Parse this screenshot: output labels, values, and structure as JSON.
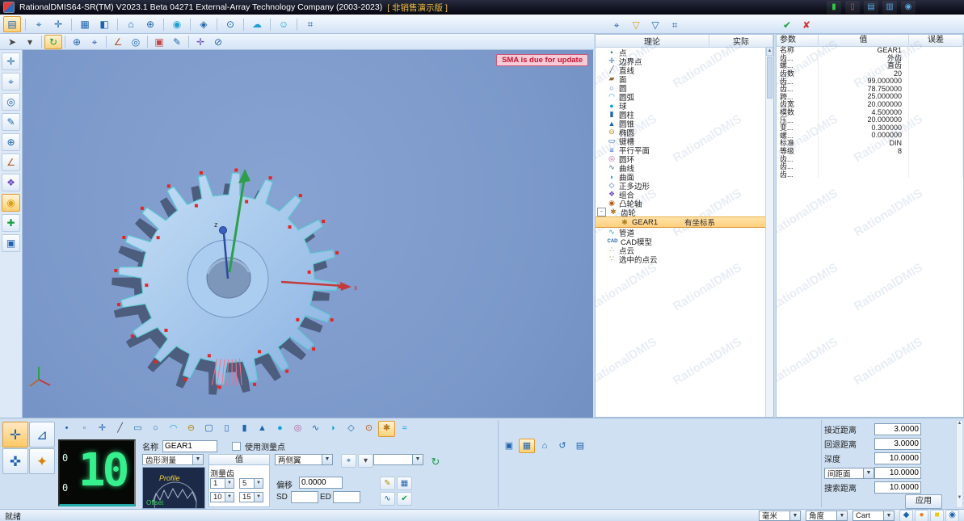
{
  "window": {
    "title": "RationalDMIS64-SR(TM) V2023.1 Beta 04271   External-Array Technology Company (2003-2023)",
    "edition": "[ 非销售演示版 ]"
  },
  "watermark": "RationalDMIS",
  "colors": {
    "selection": "#ffd27f",
    "lcd_green": "#35f08c",
    "viewport": "#7f9ccd",
    "accent_blue": "#1f63b0"
  },
  "viewport": {
    "notice": "SMA is due for update",
    "axis_z": "z",
    "axis_x": "x"
  },
  "gear": {
    "teeth": 20
  },
  "titlebar_icons": [
    {
      "name": "online-status",
      "glyph": "▮",
      "color": "#2ecc40"
    },
    {
      "name": "machine-offline",
      "glyph": "▯",
      "color": "#e74c3c"
    },
    {
      "name": "display-1",
      "glyph": "▤",
      "color": "#5aa9e6"
    },
    {
      "name": "display-2",
      "glyph": "▥",
      "color": "#5aa9e6"
    },
    {
      "name": "help",
      "glyph": "◉",
      "color": "#5aa9e6"
    }
  ],
  "toolbars": {
    "ribbon": [
      {
        "name": "file-tab",
        "glyph": "▤",
        "color": "#1f63b0",
        "active": true
      },
      {
        "sep": true
      },
      {
        "name": "probe-tab",
        "glyph": "⌖",
        "color": "#1f63b0"
      },
      {
        "name": "coordinate-tab",
        "glyph": "✛",
        "color": "#1f63b0"
      },
      {
        "sep": true
      },
      {
        "name": "table-tab",
        "glyph": "▦",
        "color": "#1f63b0"
      },
      {
        "name": "view-tab",
        "glyph": "◧",
        "color": "#1f63b0"
      },
      {
        "sep": true
      },
      {
        "name": "monitor-tab",
        "glyph": "⌂",
        "color": "#1f63b0"
      },
      {
        "name": "measure-tab",
        "glyph": "⊕",
        "color": "#1f63b0"
      },
      {
        "sep": true
      },
      {
        "name": "droplet-tab",
        "glyph": "◉",
        "color": "#18a0d8"
      },
      {
        "sep": true
      },
      {
        "name": "tolerance-tab",
        "glyph": "◈",
        "color": "#1f63b0"
      },
      {
        "sep": true
      },
      {
        "name": "gauge-tab",
        "glyph": "⊙",
        "color": "#1f63b0"
      },
      {
        "sep": true
      },
      {
        "name": "cloud-tab",
        "glyph": "☁",
        "color": "#18a0d8"
      },
      {
        "sep": true
      },
      {
        "name": "report-tab",
        "glyph": "☺",
        "color": "#18a0d8"
      },
      {
        "sep": true
      },
      {
        "name": "screen-tab",
        "glyph": "⌗",
        "color": "#1f63b0"
      }
    ],
    "quick": [
      {
        "name": "select-arrow",
        "glyph": "➤",
        "color": "#444"
      },
      {
        "name": "select-dropdown",
        "glyph": "▾",
        "color": "#444"
      },
      {
        "sep": true
      },
      {
        "name": "refresh-view",
        "glyph": "↻",
        "color": "#189e3f",
        "active": true
      },
      {
        "sep": true
      },
      {
        "name": "zoom",
        "glyph": "⊕",
        "color": "#1f63b0"
      },
      {
        "name": "locate",
        "glyph": "⌖",
        "color": "#1f63b0"
      },
      {
        "sep": true
      },
      {
        "name": "angle-tool",
        "glyph": "∠",
        "color": "#b05a1e"
      },
      {
        "name": "view-eye",
        "glyph": "◎",
        "color": "#1f63b0"
      },
      {
        "sep": true
      },
      {
        "name": "paint-surface",
        "glyph": "▣",
        "color": "#c04848"
      },
      {
        "name": "edit-tool",
        "glyph": "✎",
        "color": "#1f63b0"
      },
      {
        "sep": true
      },
      {
        "name": "probe-tool",
        "glyph": "✛",
        "color": "#6a48c0"
      },
      {
        "name": "clip-tool",
        "glyph": "⊘",
        "color": "#1f63b0"
      }
    ],
    "tree_toolbar": [
      {
        "name": "probe-display",
        "glyph": "⌖",
        "color": "#1f63b0"
      },
      {
        "name": "filter-coordinate",
        "glyph": "▽",
        "color": "#d8a018"
      },
      {
        "name": "filter-feature",
        "glyph": "▽",
        "color": "#1f63b0"
      },
      {
        "name": "report-display",
        "glyph": "⌗",
        "color": "#1f63b0"
      }
    ],
    "param_toolbar": [
      {
        "name": "confirm",
        "glyph": "✔",
        "color": "#189e3f"
      },
      {
        "name": "cancel",
        "glyph": "✘",
        "color": "#d03030"
      }
    ],
    "left_strip": [
      {
        "name": "coordinate-tool",
        "glyph": "✛",
        "color": "#1f63b0"
      },
      {
        "name": "probe-point",
        "glyph": "⌖",
        "color": "#1f63b0"
      },
      {
        "name": "view-rotate",
        "glyph": "◎",
        "color": "#1f63b0"
      },
      {
        "name": "annotate",
        "glyph": "✎",
        "color": "#1f63b0"
      },
      {
        "name": "zoom-fit",
        "glyph": "⊕",
        "color": "#1f63b0"
      },
      {
        "name": "angle-measure",
        "glyph": "∠",
        "color": "#b05a1e"
      },
      {
        "name": "combine-feature",
        "glyph": "❖",
        "color": "#6a48c0"
      },
      {
        "name": "gear-measure",
        "glyph": "◉",
        "color": "#d8a018",
        "active": true
      },
      {
        "name": "add-feature",
        "glyph": "✚",
        "color": "#189e3f"
      },
      {
        "name": "scene-settings",
        "glyph": "▣",
        "color": "#1f63b0"
      }
    ],
    "shapes": [
      {
        "name": "feature-point",
        "glyph": "•",
        "color": "#1f63b0"
      },
      {
        "name": "feature-auto-point",
        "glyph": "◦",
        "color": "#1f63b0"
      },
      {
        "name": "feature-edge-point",
        "glyph": "✛",
        "color": "#1f63b0"
      },
      {
        "name": "feature-line",
        "glyph": "╱",
        "color": "#445"
      },
      {
        "name": "feature-plane",
        "glyph": "▭",
        "color": "#1f63b0"
      },
      {
        "name": "feature-circle",
        "glyph": "○",
        "color": "#1f63b0"
      },
      {
        "name": "feature-arc",
        "glyph": "◠",
        "color": "#18a0d8"
      },
      {
        "name": "feature-ellipse",
        "glyph": "⊖",
        "color": "#b8860b"
      },
      {
        "name": "feature-slot",
        "glyph": "▢",
        "color": "#1f63b0"
      },
      {
        "name": "feature-rectangle",
        "glyph": "▯",
        "color": "#1f63b0"
      },
      {
        "name": "feature-cylinder",
        "glyph": "▮",
        "color": "#1f63b0"
      },
      {
        "name": "feature-cone",
        "glyph": "▲",
        "color": "#1f63b0"
      },
      {
        "name": "feature-sphere",
        "glyph": "●",
        "color": "#18a0d8"
      },
      {
        "name": "feature-torus",
        "glyph": "◎",
        "color": "#b05a9e"
      },
      {
        "name": "feature-curve",
        "glyph": "∿",
        "color": "#1f63b0"
      },
      {
        "name": "feature-surface",
        "glyph": "◗",
        "color": "#18a0d8"
      },
      {
        "name": "feature-polygon",
        "glyph": "◇",
        "color": "#1f63b0"
      },
      {
        "name": "feature-camshaft",
        "glyph": "⊙",
        "color": "#b05a1e"
      },
      {
        "name": "feature-gear",
        "glyph": "✱",
        "color": "#b0791e",
        "active": true
      },
      {
        "name": "feature-pipe",
        "glyph": "≈",
        "color": "#18a0d8"
      }
    ],
    "capture_row": [
      {
        "name": "capture-media",
        "glyph": "▣",
        "color": "#1f63b0"
      },
      {
        "name": "grid-view",
        "glyph": "▦",
        "color": "#1f63b0",
        "active": true
      },
      {
        "name": "home-view",
        "glyph": "⌂",
        "color": "#1f63b0"
      },
      {
        "name": "undo-view",
        "glyph": "↺",
        "color": "#1f63b0"
      },
      {
        "name": "layout-view",
        "glyph": "▤",
        "color": "#1f63b0"
      }
    ],
    "dock": [
      {
        "name": "probe-mode",
        "glyph": "✛",
        "color": "#1f63b0",
        "active": true
      },
      {
        "name": "caliper-tool",
        "glyph": "⊿",
        "color": "#1f63b0"
      },
      {
        "name": "joystick-mode",
        "glyph": "✜",
        "color": "#1f63b0"
      },
      {
        "name": "calibration-tool",
        "glyph": "✦",
        "color": "#d8860b"
      }
    ],
    "detail_icons_a": [
      {
        "name": "probe-config",
        "glyph": "⌖",
        "color": "#1f63b0"
      },
      {
        "name": "probe-config-dropdown",
        "glyph": "▾",
        "color": "#444"
      }
    ],
    "detail_icons_b": [
      {
        "name": "edit-teeth",
        "glyph": "✎",
        "color": "#b8860b"
      },
      {
        "name": "teeth-table",
        "glyph": "▦",
        "color": "#1f63b0"
      }
    ],
    "detail_icons_c": [
      {
        "name": "path-preview",
        "glyph": "∿",
        "color": "#1f63b0"
      },
      {
        "name": "confirm-teeth",
        "glyph": "✔",
        "color": "#189e3f"
      }
    ],
    "status_icons": [
      {
        "name": "status-probe",
        "glyph": "◆",
        "color": "#1f63b0"
      },
      {
        "name": "status-ball",
        "glyph": "●",
        "color": "#e67e22"
      },
      {
        "name": "status-lamp",
        "glyph": "■",
        "color": "#f1c40f"
      },
      {
        "name": "status-link",
        "glyph": "◉",
        "color": "#1f63b0"
      }
    ]
  },
  "tree": {
    "col_theory": "理论",
    "col_actual": "实际",
    "items": [
      {
        "label": "点",
        "icon": "point",
        "glyph": "•",
        "color": "#1f63b0"
      },
      {
        "label": "边界点",
        "icon": "edge-point",
        "glyph": "✛",
        "color": "#1f63b0"
      },
      {
        "label": "直线",
        "icon": "line",
        "glyph": "╱",
        "color": "#556"
      },
      {
        "label": "面",
        "icon": "plane",
        "glyph": "▰",
        "color": "#8a6d3b"
      },
      {
        "label": "圆",
        "icon": "circle",
        "glyph": "○",
        "color": "#1f63b0"
      },
      {
        "label": "圆弧",
        "icon": "arc",
        "glyph": "◠",
        "color": "#18a0d8"
      },
      {
        "label": "球",
        "icon": "sphere",
        "glyph": "●",
        "color": "#18a0d8"
      },
      {
        "label": "圆柱",
        "icon": "cylinder",
        "glyph": "▮",
        "color": "#1f63b0"
      },
      {
        "label": "圆锥",
        "icon": "cone",
        "glyph": "▲",
        "color": "#1f63b0"
      },
      {
        "label": "椭圆",
        "icon": "ellipse",
        "glyph": "⊖",
        "color": "#b8860b"
      },
      {
        "label": "键槽",
        "icon": "slot",
        "glyph": "▭",
        "color": "#1f63b0"
      },
      {
        "label": "平行平面",
        "icon": "parallel-planes",
        "glyph": "≡",
        "color": "#1f63b0"
      },
      {
        "label": "圆环",
        "icon": "torus",
        "glyph": "◎",
        "color": "#b05a9e"
      },
      {
        "label": "曲线",
        "icon": "curve",
        "glyph": "∿",
        "color": "#1f63b0"
      },
      {
        "label": "曲面",
        "icon": "surface",
        "glyph": "◗",
        "color": "#18a0d8"
      },
      {
        "label": "正多边形",
        "icon": "polygon",
        "glyph": "◇",
        "color": "#1f63b0"
      },
      {
        "label": "组合",
        "icon": "combine",
        "glyph": "❖",
        "color": "#6a48c0"
      },
      {
        "label": "凸轮轴",
        "icon": "camshaft",
        "glyph": "◉",
        "color": "#b05a1e"
      },
      {
        "label": "齿轮",
        "icon": "gear",
        "glyph": "✱",
        "color": "#b0791e",
        "expander": "-"
      },
      {
        "label": "GEAR1",
        "icon": "gear",
        "glyph": "✱",
        "color": "#b0791e",
        "child": true,
        "selected": true,
        "note": "有坐标系"
      },
      {
        "label": "管道",
        "icon": "pipe",
        "glyph": "∿",
        "color": "#18a0d8"
      },
      {
        "label": "CAD模型",
        "icon": "cad-model",
        "glyph": "CAD",
        "color": "#1f63b0",
        "textIcon": true
      },
      {
        "label": "点云",
        "icon": "point-cloud",
        "glyph": "∴",
        "color": "#6a8c3b"
      },
      {
        "label": "选中的点云",
        "icon": "selected-point-cloud",
        "glyph": "∵",
        "color": "#6a8c3b"
      }
    ]
  },
  "params": {
    "headers": [
      "参数",
      "值",
      "误差"
    ],
    "rows": [
      [
        "名称",
        "GEAR1",
        ""
      ],
      [
        "齿...",
        "外齿",
        ""
      ],
      [
        "螺...",
        "直齿",
        ""
      ],
      [
        "齿数",
        "20",
        ""
      ],
      [
        "齿...",
        "99.000000",
        ""
      ],
      [
        "齿...",
        "78.750000",
        ""
      ],
      [
        "跨...",
        "25.000000",
        ""
      ],
      [
        "齿宽",
        "20.000000",
        ""
      ],
      [
        "模数",
        "4.500000",
        ""
      ],
      [
        "压...",
        "20.000000",
        ""
      ],
      [
        "变...",
        "0.300000",
        ""
      ],
      [
        "螺...",
        "0.000000",
        ""
      ],
      [
        "标准",
        "DIN",
        ""
      ],
      [
        "等级",
        "8",
        ""
      ],
      [
        "齿...",
        "",
        ""
      ],
      [
        "齿...",
        "",
        ""
      ],
      [
        "齿...",
        "",
        ""
      ]
    ]
  },
  "bottom": {
    "name_label": "名称",
    "name_value": "GEAR1",
    "use_points_label": "使用测量点",
    "measure_type_value": "齿形测量",
    "value_header": "值",
    "side_value": "两侧翼",
    "measure_teeth_label": "测量齿",
    "offset_label": "偏移",
    "offset_value": "0.0000",
    "sd_label": "SD",
    "ed_label": "ED",
    "spin1": "1",
    "spin2": "5",
    "spin3": "10",
    "spin4": "15",
    "lcd": {
      "small_top": "0",
      "small_bottom": "0",
      "big": "10"
    },
    "preview": {
      "profile": "Profile",
      "offset": "Offset"
    }
  },
  "dist": {
    "rows": [
      {
        "label": "接近距离",
        "value": "3.0000"
      },
      {
        "label": "回退距离",
        "value": "3.0000"
      },
      {
        "label": "深度",
        "value": "10.0000"
      },
      {
        "label": "间距面",
        "value": "10.0000",
        "dropdown": true
      },
      {
        "label": "搜索距离",
        "value": "10.0000"
      }
    ],
    "apply": "应用"
  },
  "status": {
    "ready": "就绪",
    "units": "毫米",
    "angle": "角度",
    "coord": "Cart"
  }
}
